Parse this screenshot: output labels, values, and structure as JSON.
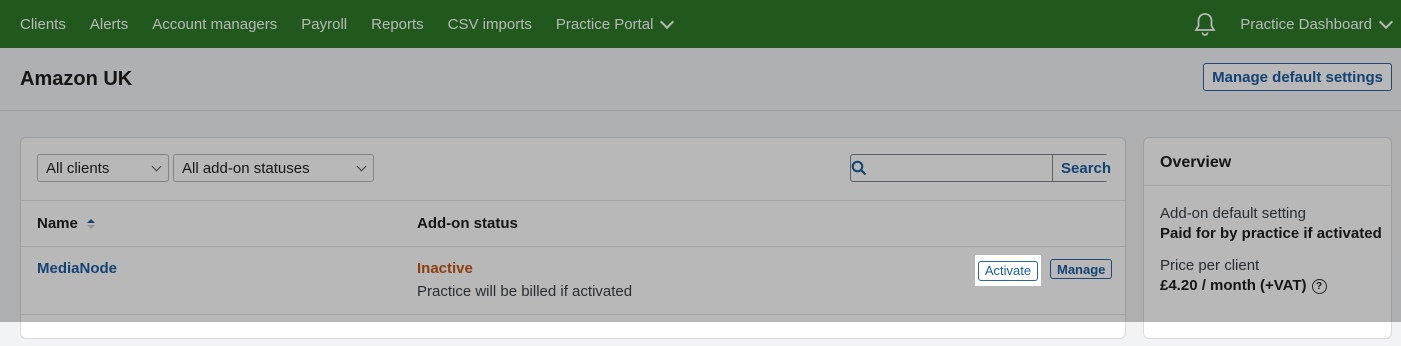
{
  "nav": {
    "items": [
      "Clients",
      "Alerts",
      "Account managers",
      "Payroll",
      "Reports",
      "CSV imports",
      "Practice Portal"
    ],
    "dashboard": "Practice Dashboard"
  },
  "header": {
    "title": "Amazon UK",
    "manage_default": "Manage default settings"
  },
  "filters": {
    "clients": "All clients",
    "statuses": "All add-on statuses",
    "search_placeholder": "",
    "search_button": "Search"
  },
  "table": {
    "headers": [
      "Name",
      "Add-on status"
    ],
    "rows": [
      {
        "name": "MediaNode",
        "status": "Inactive",
        "note": "Practice will be billed if activated",
        "activate": "Activate",
        "manage": "Manage"
      }
    ]
  },
  "overview": {
    "title": "Overview",
    "default_label": "Add-on default setting",
    "default_value": "Paid for by practice if activated",
    "price_label": "Price per client",
    "price_value": "£4.20 / month (+VAT)",
    "help_glyph": "?"
  },
  "colors": {
    "nav_bg": "#2d7a2a",
    "link": "#1c5ea0",
    "inactive": "#c45515"
  }
}
